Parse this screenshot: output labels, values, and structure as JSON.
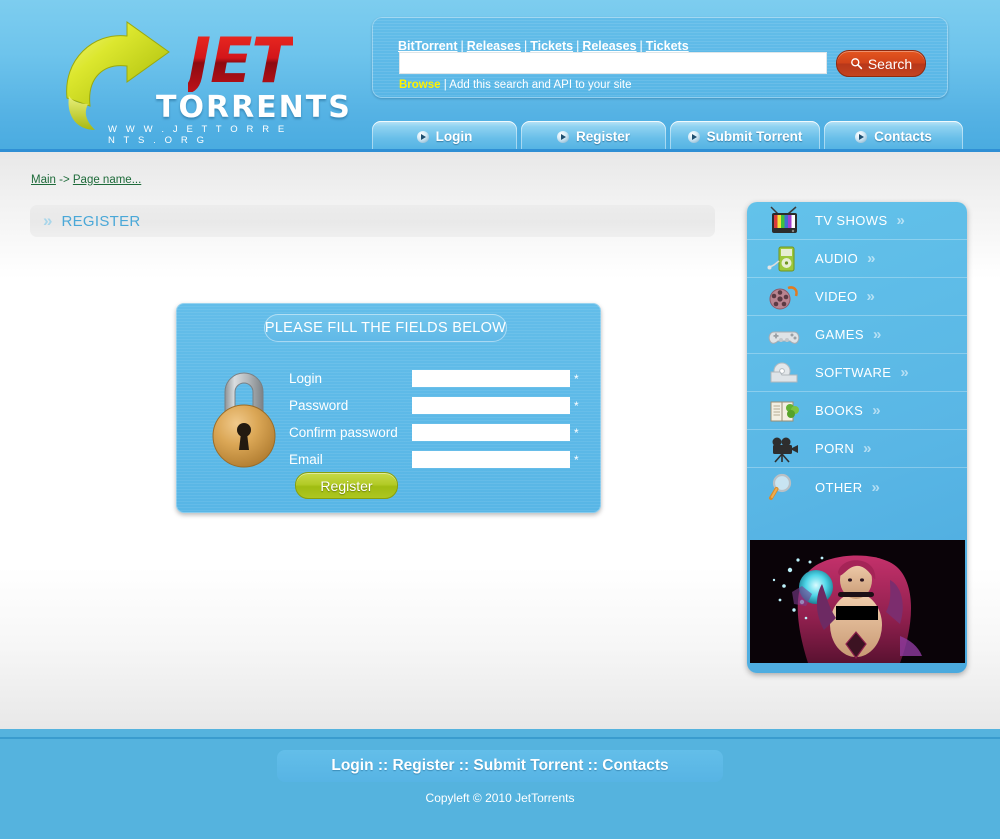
{
  "site": {
    "logo_jet": "JET",
    "logo_torrents": "TORRENTS",
    "logo_url": "W W W . J E T T O R R E N T S . O R G"
  },
  "search": {
    "links": [
      "BitTorrent",
      "Releases",
      "Tickets",
      "Releases",
      "Tickets"
    ],
    "separator": "|",
    "input_value": "",
    "input_placeholder": "",
    "button_label": "Search",
    "button_icon": "search-icon",
    "browse_label": "Browse",
    "sub_text": "| Add this search and API to your site"
  },
  "tabs": [
    {
      "label": "Login",
      "icon": "play-circle-icon"
    },
    {
      "label": "Register",
      "icon": "play-circle-icon"
    },
    {
      "label": "Submit Torrent",
      "icon": "play-circle-icon"
    },
    {
      "label": "Contacts",
      "icon": "play-circle-icon"
    }
  ],
  "breadcrumb": {
    "root": "Main",
    "arrow": " -> ",
    "current": "Page name..."
  },
  "page": {
    "title": "REGISTER",
    "chevron": "»"
  },
  "form": {
    "heading": "PLEASE FILL THE FIELDS BELOW",
    "lock_icon": "padlock-icon",
    "fields": [
      {
        "label": "Login",
        "value": "",
        "required_marker": "*",
        "name": "login"
      },
      {
        "label": "Password",
        "value": "",
        "required_marker": "*",
        "name": "password"
      },
      {
        "label": "Confirm password",
        "value": "",
        "required_marker": "*",
        "name": "confirm-password"
      },
      {
        "label": "Email",
        "value": "",
        "required_marker": "*",
        "name": "email"
      }
    ],
    "submit_label": "Register"
  },
  "sidebar": {
    "categories": [
      {
        "label": "TV SHOWS",
        "icon": "television-icon",
        "chevron": "»"
      },
      {
        "label": "AUDIO",
        "icon": "mp3-player-icon",
        "chevron": "»"
      },
      {
        "label": "VIDEO",
        "icon": "film-reel-icon",
        "chevron": "»"
      },
      {
        "label": "GAMES",
        "icon": "gamepad-icon",
        "chevron": "»"
      },
      {
        "label": "SOFTWARE",
        "icon": "cd-case-icon",
        "chevron": "»"
      },
      {
        "label": "BOOKS",
        "icon": "open-book-icon",
        "chevron": "»"
      },
      {
        "label": "PORN",
        "icon": "movie-camera-icon",
        "chevron": "»"
      },
      {
        "label": "OTHER",
        "icon": "magnifier-icon",
        "chevron": "»"
      }
    ],
    "banner_alt": "advertisement-banner"
  },
  "footer": {
    "nav_text": "Login :: Register :: Submit Torrent :: Contacts",
    "copyright": "Copyleft © 2010 JetTorrents"
  },
  "colors": {
    "header_top": "#7dcdef",
    "header_bottom": "#49abe0",
    "panel_blue": "#5fb9e7",
    "search_button": "#d0421a",
    "register_button": "#b3cb27",
    "title_text": "#4aa8d8",
    "breadcrumb_link": "#1e6b3a",
    "browse_yellow": "#fff200"
  }
}
